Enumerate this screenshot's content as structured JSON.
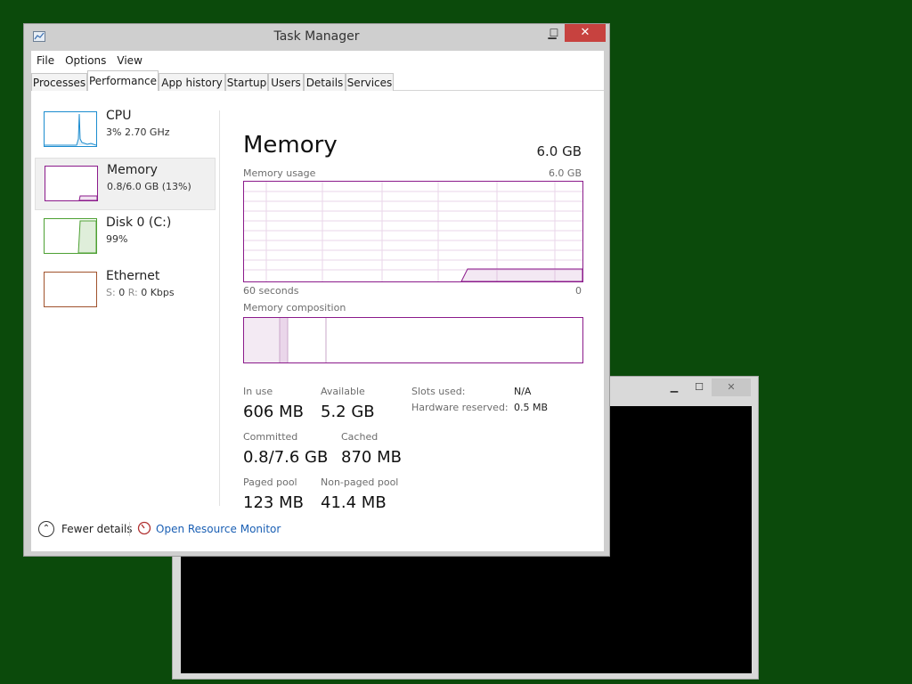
{
  "window": {
    "title": "Task Manager",
    "minimize_glyph": "▁",
    "maximize_glyph": "☐",
    "close_glyph": "✕"
  },
  "menu": [
    "File",
    "Options",
    "View"
  ],
  "tabs": [
    {
      "label": "Processes",
      "active": false
    },
    {
      "label": "Performance",
      "active": true
    },
    {
      "label": "App history",
      "active": false
    },
    {
      "label": "Startup",
      "active": false
    },
    {
      "label": "Users",
      "active": false
    },
    {
      "label": "Details",
      "active": false
    },
    {
      "label": "Services",
      "active": false
    }
  ],
  "sidebar": {
    "items": [
      {
        "title": "CPU",
        "subtitle": "3%  2.70 GHz",
        "color": "#1c8ccf",
        "selected": false
      },
      {
        "title": "Memory",
        "subtitle": "0.8/6.0 GB (13%)",
        "color": "#8b1a8b",
        "selected": true
      },
      {
        "title": "Disk 0 (C:)",
        "subtitle": "99%",
        "color": "#4da033",
        "selected": false
      },
      {
        "title": "Ethernet",
        "subtitle_s": "S:",
        "subtitle_s_val": "0",
        "subtitle_r": "R:",
        "subtitle_r_val": "0 Kbps",
        "color": "#a0522d",
        "selected": false
      }
    ]
  },
  "main": {
    "title": "Memory",
    "total": "6.0 GB",
    "usage_label": "Memory usage",
    "usage_max": "6.0 GB",
    "time_left": "60 seconds",
    "time_right": "0",
    "composition_label": "Memory composition",
    "stats": {
      "in_use_label": "In use",
      "in_use": "606 MB",
      "available_label": "Available",
      "available": "5.2 GB",
      "committed_label": "Committed",
      "committed": "0.8/7.6 GB",
      "cached_label": "Cached",
      "cached": "870 MB",
      "paged_label": "Paged pool",
      "paged": "123 MB",
      "nonpaged_label": "Non-paged pool",
      "nonpaged": "41.4 MB",
      "slots_label": "Slots used:",
      "slots": "N/A",
      "hw_label": "Hardware reserved:",
      "hw": "0.5 MB"
    }
  },
  "footer": {
    "fewer_details": "Fewer details",
    "open_resource_monitor": "Open Resource Monitor"
  },
  "colors": {
    "memory": "#8b1a8b",
    "desktop": "#0b4a0b",
    "link": "#1a5fb4",
    "close": "#c7423f"
  }
}
